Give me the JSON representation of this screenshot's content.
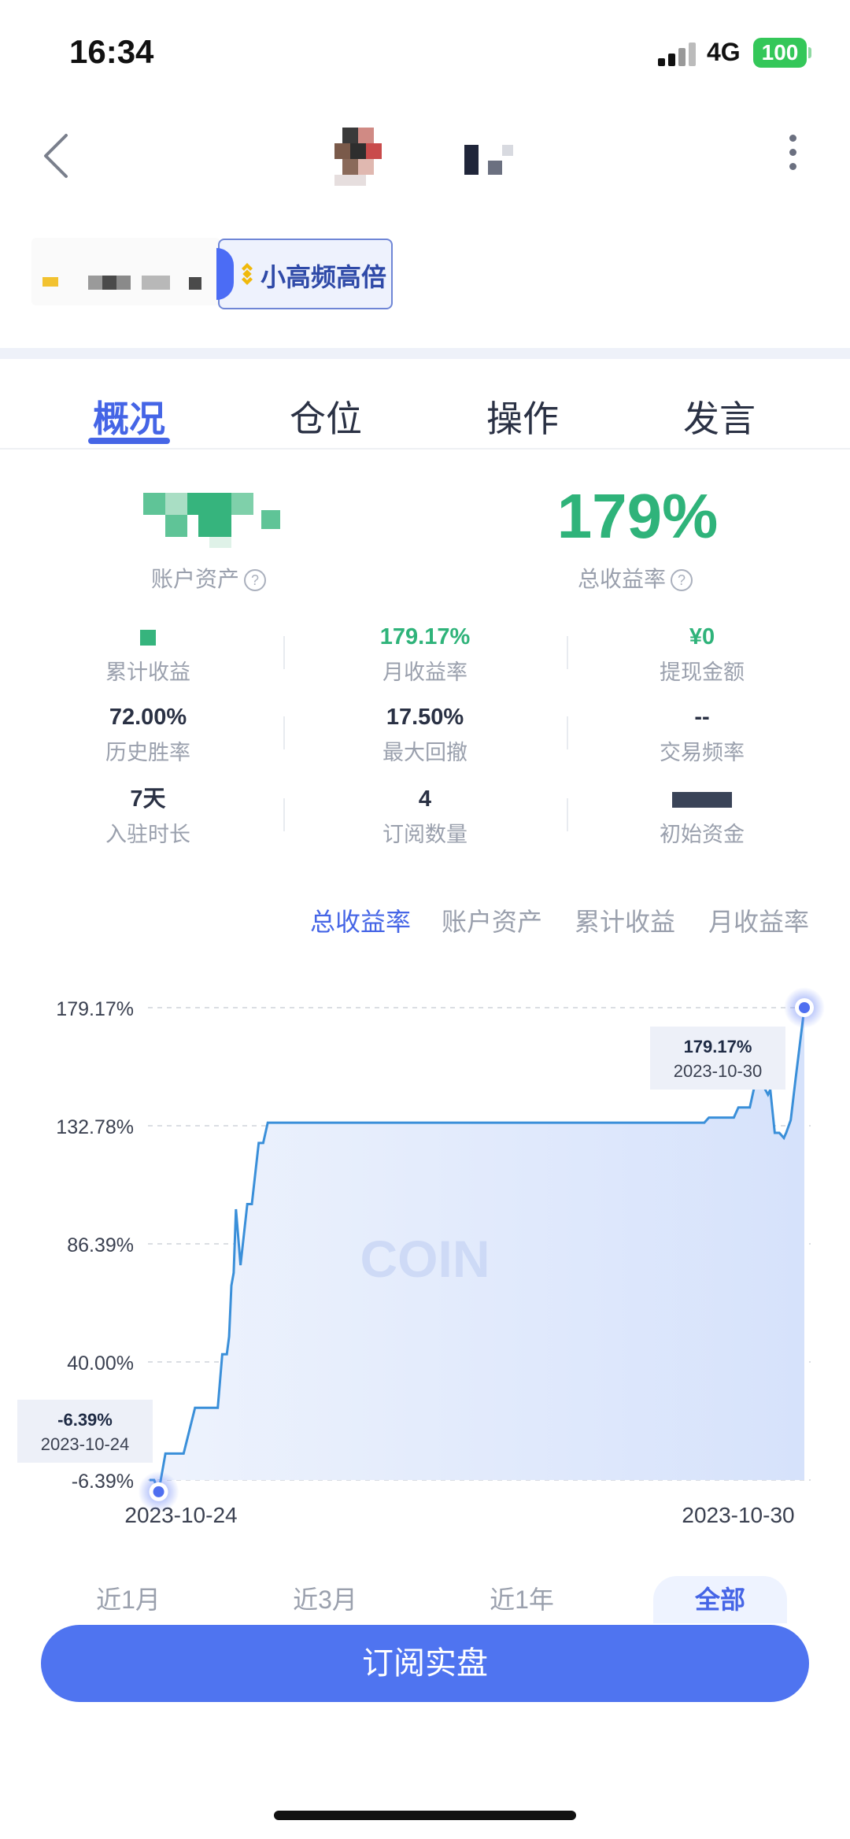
{
  "status_bar": {
    "time": "16:34",
    "network": "4G",
    "battery": "100"
  },
  "tag": {
    "label": "小高频高倍"
  },
  "tabs": [
    "概况",
    "仓位",
    "操作",
    "发言"
  ],
  "summary": {
    "total_return_value": "179%",
    "account_assets_label": "账户资产",
    "total_return_label": "总收益率"
  },
  "stats": [
    {
      "value": "",
      "label": "累计收益"
    },
    {
      "value": "179.17%",
      "label": "月收益率",
      "green": true
    },
    {
      "value": "¥0",
      "label": "提现金额",
      "green": true
    },
    {
      "value": "72.00%",
      "label": "历史胜率"
    },
    {
      "value": "17.50%",
      "label": "最大回撤"
    },
    {
      "value": "--",
      "label": "交易频率"
    },
    {
      "value": "7天",
      "label": "入驻时长"
    },
    {
      "value": "4",
      "label": "订阅数量"
    },
    {
      "value": "",
      "label": "初始资金"
    }
  ],
  "chart_tabs": [
    "总收益率",
    "账户资产",
    "累计收益",
    "月收益率"
  ],
  "chart_data": {
    "type": "area",
    "watermark": "COIN",
    "y_ticks": [
      "179.17%",
      "132.78%",
      "86.39%",
      "40.00%",
      "-6.39%"
    ],
    "ylim": [
      -6.39,
      179.17
    ],
    "x_labels": [
      "2023-10-24",
      "2023-10-30"
    ],
    "x_range": [
      "2023-10-24",
      "2023-10-30"
    ],
    "series": [
      {
        "x": [
          "2023-10-24 00:00",
          "2023-10-24 00:30",
          "2023-10-24 01:00",
          "2023-10-24 02:00",
          "2023-10-24 03:30",
          "2023-10-24 04:30",
          "2023-10-24 05:00",
          "2023-10-24 07:30",
          "2023-10-24 10:00",
          "2023-10-24 10:30",
          "2023-10-24 14:00",
          "2023-10-24 15:00",
          "2023-10-24 16:00",
          "2023-10-24 16:30",
          "2023-10-24 17:00",
          "2023-10-24 17:30",
          "2023-10-24 18:00",
          "2023-10-24 18:30",
          "2023-10-24 19:00",
          "2023-10-24 20:00",
          "2023-10-24 21:30",
          "2023-10-24 22:30",
          "2023-10-25 00:00",
          "2023-10-25 01:00",
          "2023-10-25 02:00",
          "2023-10-29 02:00",
          "2023-10-29 03:00",
          "2023-10-29 05:00",
          "2023-10-29 06:30",
          "2023-10-29 07:30",
          "2023-10-29 08:30",
          "2023-10-29 09:30",
          "2023-10-29 10:30",
          "2023-10-29 12:00",
          "2023-10-29 13:00",
          "2023-10-29 14:30",
          "2023-10-29 16:00",
          "2023-10-29 16:30",
          "2023-10-29 17:30",
          "2023-10-29 18:30",
          "2023-10-29 19:30",
          "2023-10-29 20:00",
          "2023-10-29 21:00",
          "2023-10-29 22:00",
          "2023-10-30 00:00"
        ],
        "y": [
          -6.39,
          -6.39,
          -6.39,
          -11.0,
          4.0,
          4.0,
          4.0,
          4.0,
          22.0,
          22.0,
          22.0,
          22.0,
          43.0,
          43.0,
          43.0,
          50.0,
          70.0,
          75.0,
          100.0,
          78.0,
          102.0,
          102.0,
          126.0,
          126.0,
          134.0,
          134.0,
          136.0,
          136.0,
          136.0,
          136.0,
          136.0,
          140.0,
          140.0,
          140.0,
          148.0,
          150.0,
          145.0,
          147.0,
          130.0,
          130.0,
          128.0,
          130.0,
          135.0,
          150.0,
          179.17
        ]
      }
    ],
    "tooltips": [
      {
        "value": "179.17%",
        "date": "2023-10-30"
      },
      {
        "value": "-6.39%",
        "date": "2023-10-24"
      }
    ]
  },
  "ranges": [
    "近1月",
    "近3月",
    "近1年",
    "全部"
  ],
  "subscribe_label": "订阅实盘",
  "colors": {
    "accent": "#4565e6",
    "green": "#2fb37a",
    "line": "#3a8fd9",
    "button": "#4f74f0"
  }
}
